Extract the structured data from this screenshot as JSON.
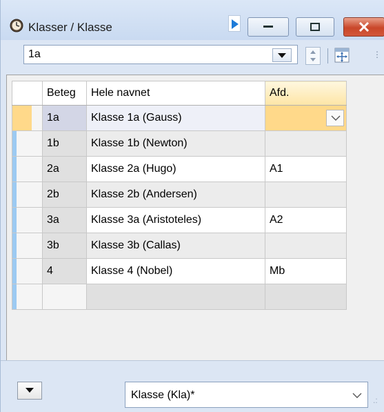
{
  "window": {
    "title": "Klasser / Klasse",
    "icons": {
      "app": "clock-gear-icon",
      "pin": "play-arrow-icon"
    }
  },
  "selector": {
    "value": "1a",
    "icons": {
      "dropdown": "chevron-down-icon",
      "spinner": "spin-updown-icon",
      "grid": "grid-settings-icon"
    }
  },
  "grid": {
    "headers": {
      "beteg": "Beteg",
      "name": "Hele navnet",
      "afd": "Afd."
    },
    "rows": [
      {
        "beteg": "1a",
        "name": "Klasse 1a (Gauss)",
        "afd": ""
      },
      {
        "beteg": "1b",
        "name": "Klasse 1b (Newton)",
        "afd": ""
      },
      {
        "beteg": "2a",
        "name": "Klasse 2a (Hugo)",
        "afd": "A1"
      },
      {
        "beteg": "2b",
        "name": "Klasse 2b (Andersen)",
        "afd": ""
      },
      {
        "beteg": "3a",
        "name": "Klasse 3a (Aristoteles)",
        "afd": "A2"
      },
      {
        "beteg": "3b",
        "name": "Klasse 3b (Callas)",
        "afd": ""
      },
      {
        "beteg": "4",
        "name": "Klasse 4 (Nobel)",
        "afd": "Mb"
      }
    ]
  },
  "footer": {
    "view_select": "Klasse (Kla)*"
  },
  "colors": {
    "selection_bar": "#9ccaf2",
    "active_cell": "#ffd98a",
    "close_button": "#c9472a"
  }
}
